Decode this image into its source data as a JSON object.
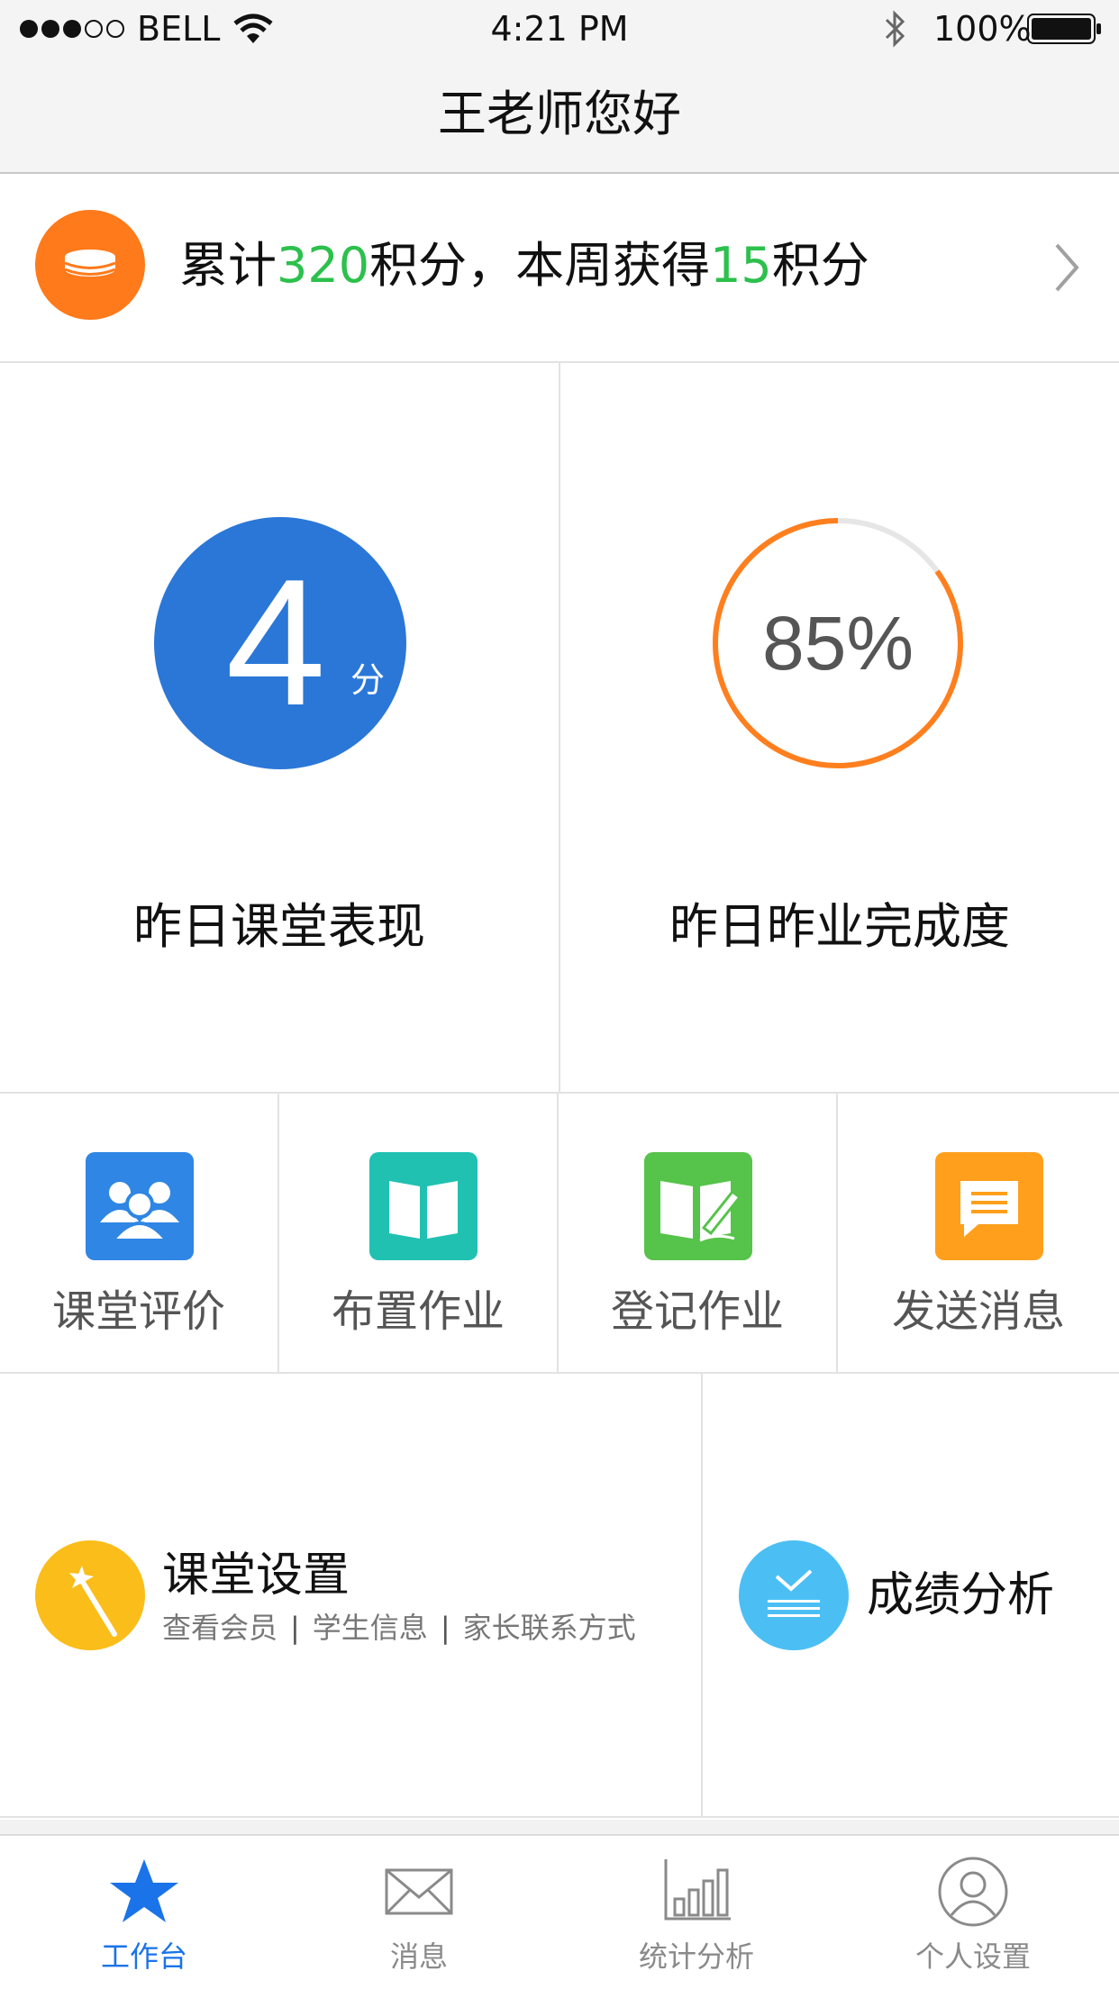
{
  "status_bar": {
    "carrier": "BELL",
    "time": "4:21 PM",
    "battery": "100%"
  },
  "nav": {
    "title": "王老师您好"
  },
  "points": {
    "prefix": "累计",
    "total": "320",
    "middle": "积分，本周获得",
    "week": "15",
    "suffix": "积分"
  },
  "stats": {
    "class_score": {
      "value": "4",
      "unit": "分",
      "label": "昨日课堂表现"
    },
    "homework": {
      "percent": 85,
      "percent_text": "85%",
      "label": "昨日昨业完成度"
    }
  },
  "actions": [
    {
      "label": "课堂评价",
      "icon": "group-icon",
      "color": "#2f86e4"
    },
    {
      "label": "布置作业",
      "icon": "book-icon",
      "color": "#20c1b1"
    },
    {
      "label": "登记作业",
      "icon": "book-pen-icon",
      "color": "#56c34a"
    },
    {
      "label": "发送消息",
      "icon": "chat-icon",
      "color": "#ff9f1c"
    }
  ],
  "features": {
    "class_settings": {
      "title": "课堂设置",
      "links": [
        "查看会员",
        "学生信息",
        "家长联系方式"
      ],
      "separator": "|"
    },
    "grade_analysis": {
      "title": "成绩分析"
    }
  },
  "tabs": [
    {
      "label": "工作台",
      "icon": "star-icon",
      "active": true
    },
    {
      "label": "消息",
      "icon": "mail-icon",
      "active": false
    },
    {
      "label": "统计分析",
      "icon": "bar-chart-icon",
      "active": false
    },
    {
      "label": "个人设置",
      "icon": "user-icon",
      "active": false
    }
  ],
  "colors": {
    "accent_blue": "#2a77d8",
    "accent_orange": "#ff7a1a",
    "accent_green": "#2cc04c",
    "progress_track": "#e6e6e6",
    "progress_fill": "#ff7f1e",
    "tab_active": "#1a73e8"
  }
}
